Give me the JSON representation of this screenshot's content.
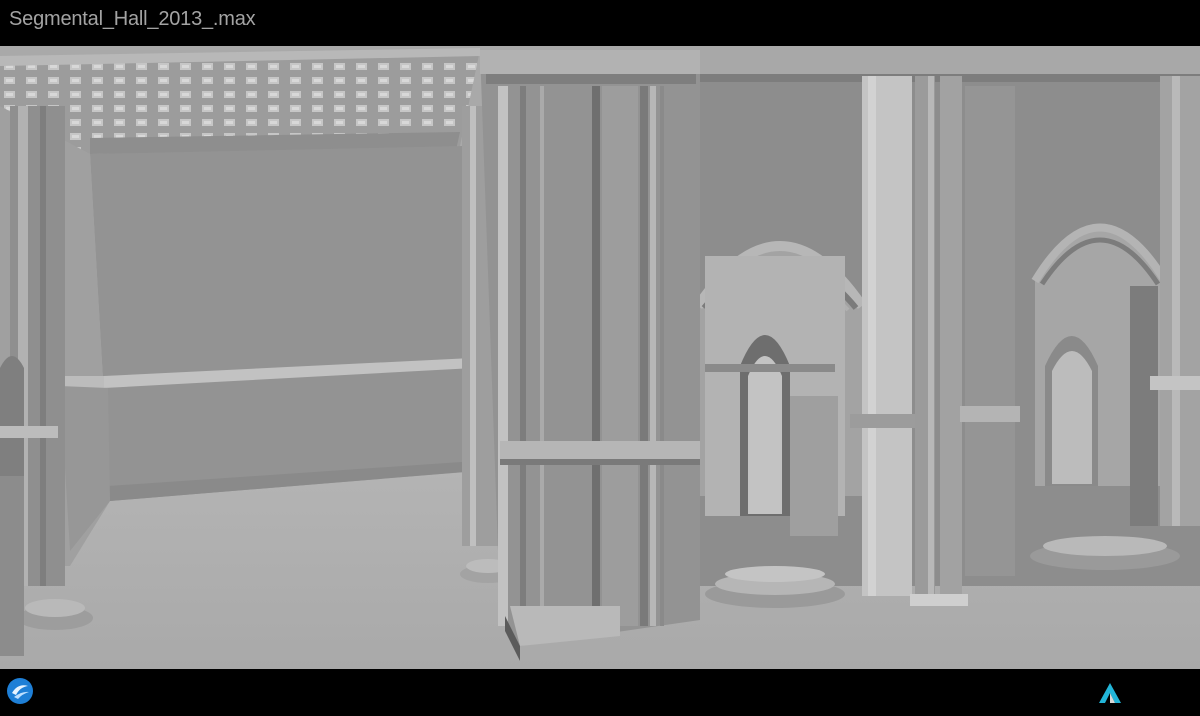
{
  "window": {
    "title": "Segmental_Hall_2013_.max"
  },
  "colors": {
    "background": "#000000",
    "title_text": "#a3a3a3",
    "scene_gray": "#9a9a9a",
    "accent_blue": "#1e7fd6",
    "autodesk_teal": "#22b5d8"
  },
  "icons": {
    "left": "app-icon",
    "right": "autodesk-logo-icon"
  }
}
